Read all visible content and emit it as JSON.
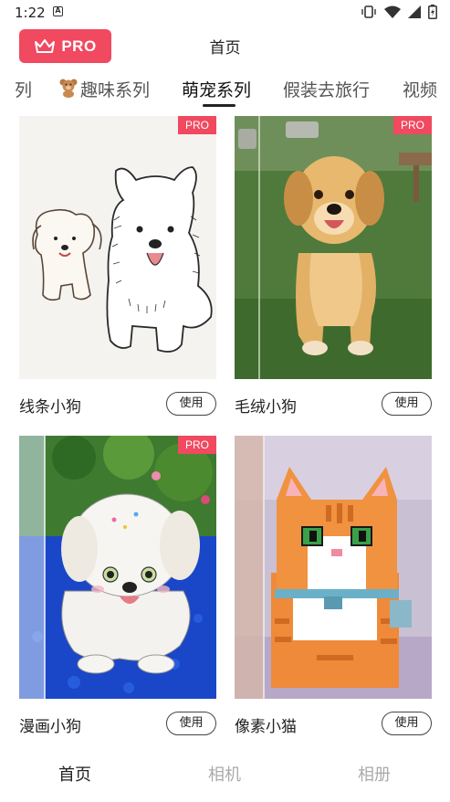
{
  "status_bar": {
    "time": "1:22",
    "notification_letter": "A"
  },
  "header": {
    "pro_label": "PRO",
    "title": "首页"
  },
  "tabs": [
    {
      "label": "列"
    },
    {
      "label": "趣味系列"
    },
    {
      "label": "萌宠系列"
    },
    {
      "label": "假装去旅行"
    },
    {
      "label": "视频"
    }
  ],
  "active_tab": "萌宠系列",
  "cards": [
    {
      "name": "线条小狗",
      "badge": "PRO",
      "button": "使用"
    },
    {
      "name": "毛绒小狗",
      "badge": "PRO",
      "button": "使用"
    },
    {
      "name": "漫画小狗",
      "badge": "PRO",
      "button": "使用"
    },
    {
      "name": "像素小猫",
      "badge": "",
      "button": "使用"
    }
  ],
  "bottom_nav": [
    {
      "label": "首页"
    },
    {
      "label": "相机"
    },
    {
      "label": "相册"
    }
  ],
  "colors": {
    "accent": "#f04960",
    "nav_active": "#222222",
    "nav_inactive": "#aaaaaa"
  }
}
